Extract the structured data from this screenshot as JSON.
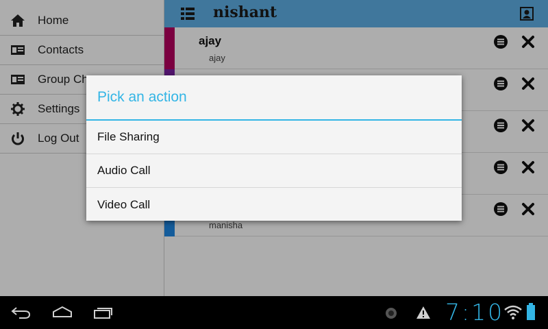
{
  "sidebar": {
    "items": [
      {
        "label": "Home",
        "icon": "home-icon"
      },
      {
        "label": "Contacts",
        "icon": "contact-card-icon"
      },
      {
        "label": "Group Ch",
        "icon": "group-card-icon"
      },
      {
        "label": "Settings",
        "icon": "gear-icon"
      },
      {
        "label": "Log Out",
        "icon": "power-icon"
      }
    ]
  },
  "appbar": {
    "title": "nishant",
    "background": "#5fb0e6"
  },
  "chats": [
    {
      "name": "ajay",
      "sub": "ajay",
      "color": "#b5005f"
    },
    {
      "name": "",
      "sub": "",
      "color": "#7a1fa2"
    },
    {
      "name": "",
      "sub": "",
      "color": "#2e7d32"
    },
    {
      "name": "",
      "sub": "",
      "color": "#ef6c00"
    },
    {
      "name": "",
      "sub": "manisha",
      "color": "#1e88e5"
    }
  ],
  "dialog": {
    "title": "Pick an action",
    "options": [
      "File Sharing",
      "Audio Call",
      "Video Call"
    ],
    "accent": "#33b5e5"
  },
  "system_bar": {
    "clock": "7:10",
    "icons": [
      "back-icon",
      "home-nav-icon",
      "recents-icon",
      "notification-dot-icon",
      "warning-icon",
      "wifi-icon",
      "battery-icon"
    ]
  }
}
